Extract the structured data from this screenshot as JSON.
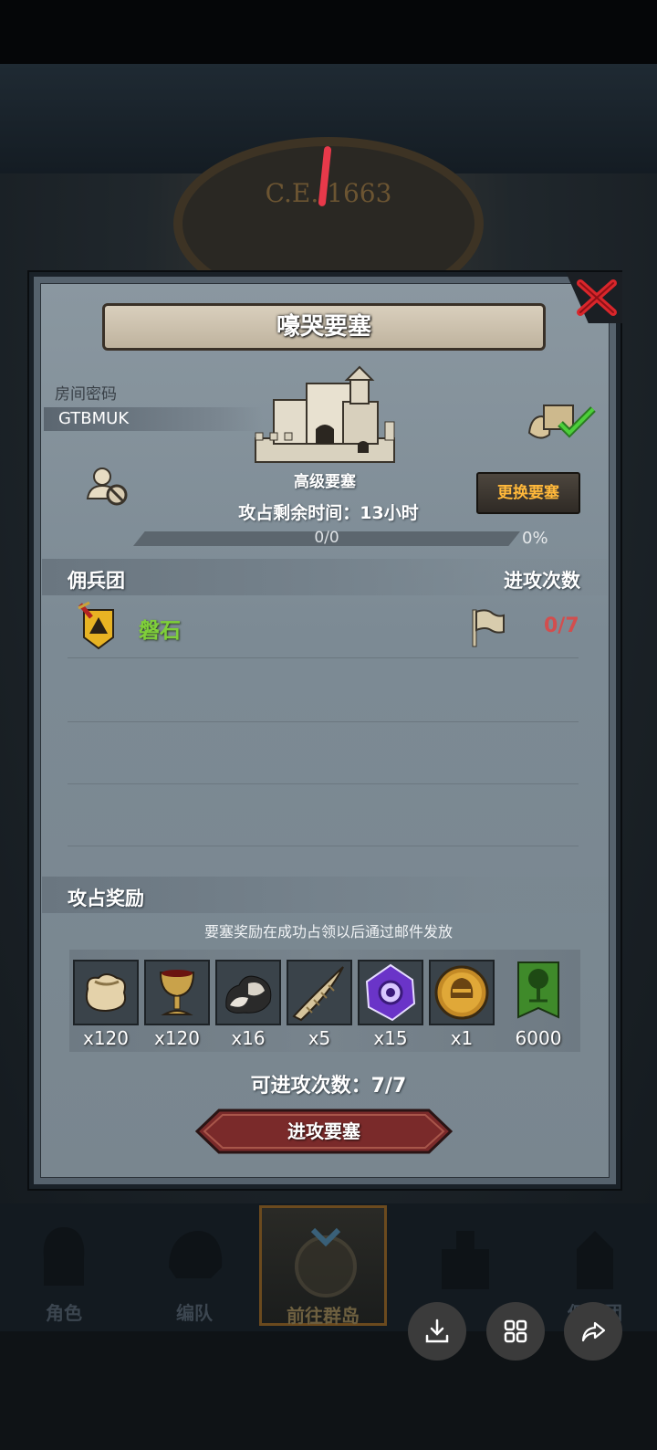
{
  "background": {
    "era_text": "C.E. 1663"
  },
  "dialog": {
    "title": "嚎哭要塞",
    "room_password_label": "房间密码",
    "room_password_value": "GTBMUK",
    "fortress_level": "高级要塞",
    "change_fortress_button": "更换要塞",
    "occupation_time_text": "攻占剩余时间：13小时",
    "progress": {
      "fraction_text": "0/0",
      "percent_text": "0%",
      "value": 0
    },
    "mercenary_section": {
      "left_header": "佣兵团",
      "right_header": "进攻次数",
      "rows": [
        {
          "name": "磐石",
          "attack_count": "0/7"
        }
      ]
    },
    "rewards_section": {
      "header": "攻占奖励",
      "note": "要塞奖励在成功占领以后通过邮件发放",
      "items": [
        {
          "icon": "sack-icon",
          "qty": "x120"
        },
        {
          "icon": "goblet-icon",
          "qty": "x120"
        },
        {
          "icon": "ore-icon",
          "qty": "x16"
        },
        {
          "icon": "horn-icon",
          "qty": "x5"
        },
        {
          "icon": "crystal-icon",
          "qty": "x15"
        },
        {
          "icon": "helmet-coin-icon",
          "qty": "x1"
        },
        {
          "icon": "tree-banner-icon",
          "qty": "6000"
        }
      ]
    },
    "available_attacks_text": "可进攻次数：7/7",
    "attack_button": "进攻要塞"
  },
  "bottom_nav": {
    "items": [
      {
        "label": "角色",
        "icon": "knight-icon"
      },
      {
        "label": "编队",
        "icon": "helmet-icon"
      },
      {
        "label": "前往群岛",
        "icon": "compass-icon",
        "active": true
      },
      {
        "label": "",
        "icon": "castle-icon"
      },
      {
        "label": "佣兵团",
        "icon": "mercenary-icon"
      }
    ]
  },
  "overlay_buttons": [
    "download-icon",
    "grid-icon",
    "share-icon"
  ],
  "colors": {
    "panel": "#7c8a94",
    "accent_gold": "#ffb83a",
    "merc_green": "#7fcf3a",
    "count_red": "#d24e4e",
    "close_red": "#d9262b",
    "attack_button": "#7a2a2a"
  }
}
